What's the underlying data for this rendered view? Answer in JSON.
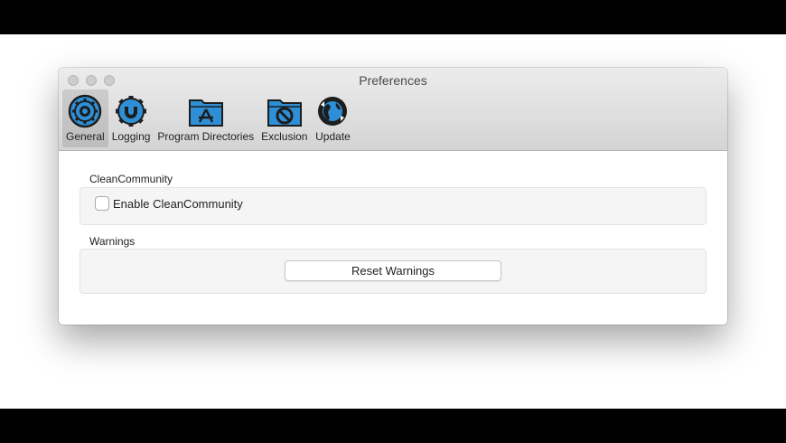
{
  "window": {
    "title": "Preferences"
  },
  "toolbar": {
    "items": [
      {
        "label": "General",
        "icon": "gear-icon",
        "selected": true
      },
      {
        "label": "Logging",
        "icon": "log-magnet-icon",
        "selected": false
      },
      {
        "label": "Program Directories",
        "icon": "app-folder-icon",
        "selected": false
      },
      {
        "label": "Exclusion",
        "icon": "exclusion-folder-icon",
        "selected": false
      },
      {
        "label": "Update",
        "icon": "globe-update-icon",
        "selected": false
      }
    ]
  },
  "clean_community": {
    "title": "CleanCommunity",
    "checkbox_label": "Enable CleanCommunity",
    "checked": false
  },
  "warnings": {
    "title": "Warnings",
    "reset_label": "Reset Warnings"
  },
  "colors": {
    "icon_blue": "#2e8fd6",
    "icon_dark": "#1d1d1d",
    "selected_bg": "#d9d9d9"
  }
}
